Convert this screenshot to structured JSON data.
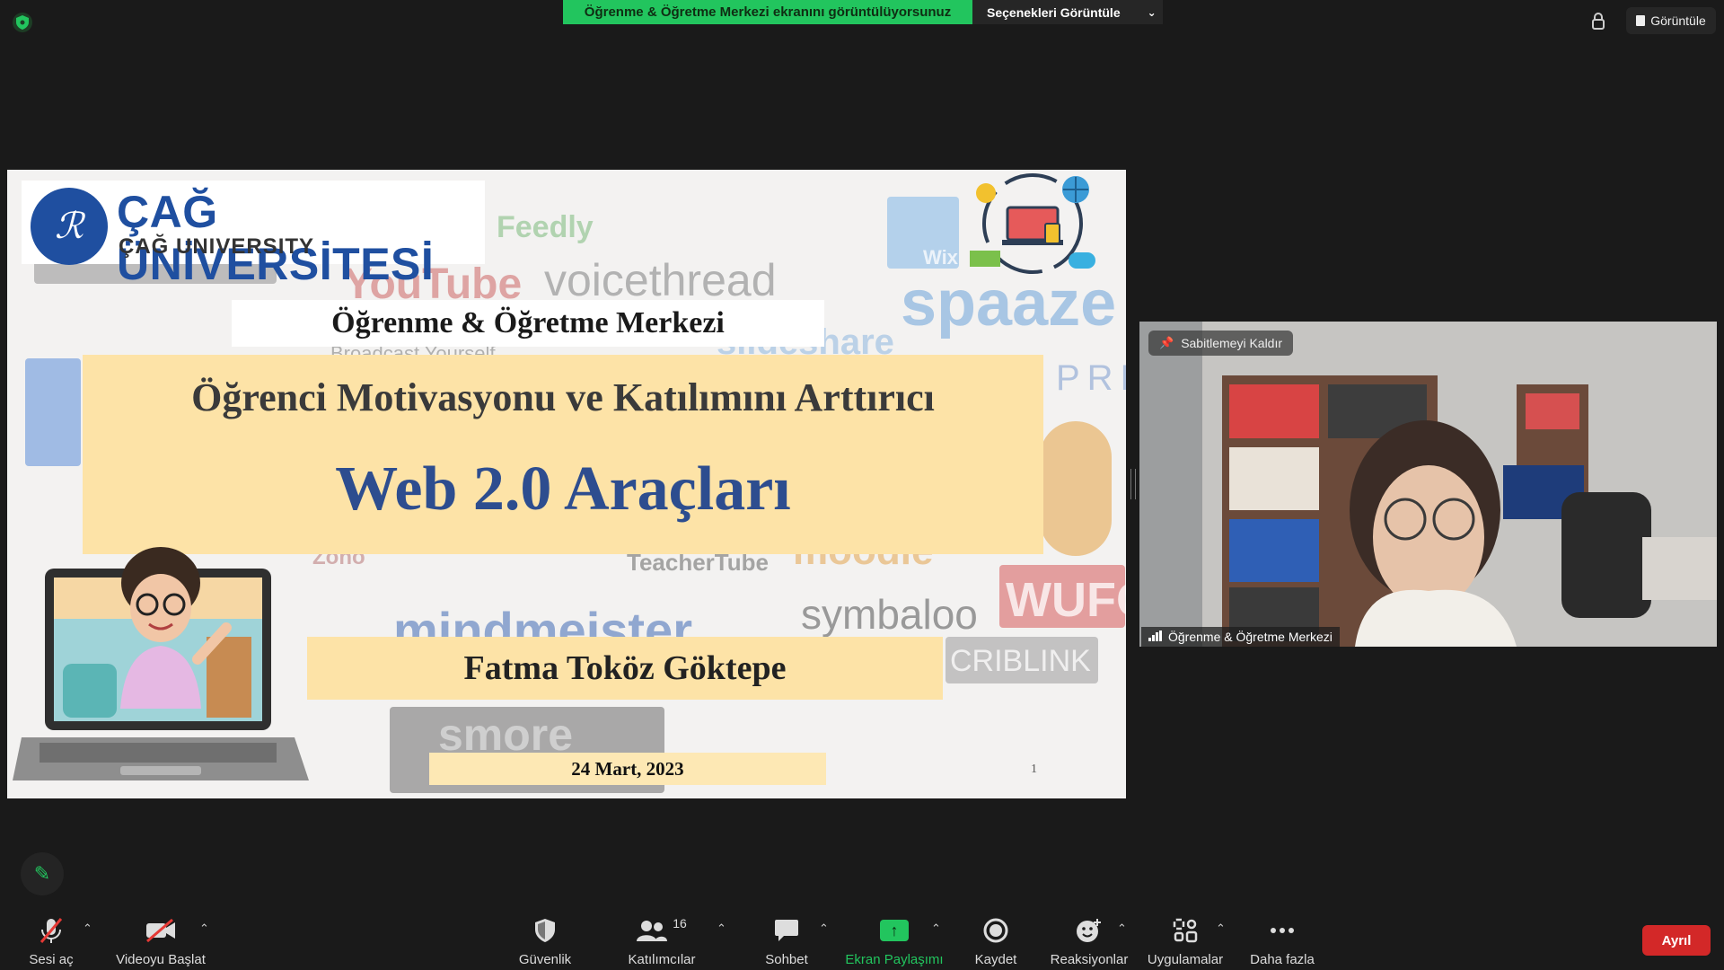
{
  "top": {
    "share_banner": "Öğrenme & Öğretme Merkezi ekranını görüntülüyorsunuz",
    "view_options": "Seçenekleri Görüntüle",
    "view_button": "Görüntüle"
  },
  "slide": {
    "logo_title": "ÇAĞ ÜNİVERSİTESİ",
    "logo_sub": "ÇAĞ UNIVERSITY",
    "center_title": "Öğrenme & Öğretme Merkezi",
    "main_line1": "Öğrenci Motivasyonu ve Katılımını Arttırıcı",
    "main_line2": "Web 2.0 Araçları",
    "author": "Fatma Toköz Göktepe",
    "date": "24 Mart, 2023",
    "page_number": "1",
    "background_words": [
      "Feedly",
      "YouTube",
      "voicethread",
      "spaaze",
      "slideshare",
      "Wix",
      "symbaloo",
      "mindmeister",
      "moodle",
      "WUFOO",
      "CRIBLINK",
      "smore",
      "PRE",
      "TeacherTube",
      "Zoho",
      "Broadcast Yourself"
    ]
  },
  "video": {
    "unpin_label": "Sabitlemeyi Kaldır",
    "participant_name": "Öğrenme & Öğretme Merkezi"
  },
  "toolbar": {
    "unmute": "Sesi aç",
    "start_video": "Videoyu Başlat",
    "security": "Güvenlik",
    "participants": "Katılımcılar",
    "participant_count": "16",
    "chat": "Sohbet",
    "share_screen": "Ekran Paylaşımı",
    "record": "Kaydet",
    "reactions": "Reaksiyonlar",
    "apps": "Uygulamalar",
    "more": "Daha fazla",
    "leave": "Ayrıl"
  },
  "colors": {
    "share_green": "#22c55e",
    "leave_red": "#d32828",
    "slide_accent_blue": "#2d4d8f",
    "slide_highlight": "#fde3a7"
  }
}
